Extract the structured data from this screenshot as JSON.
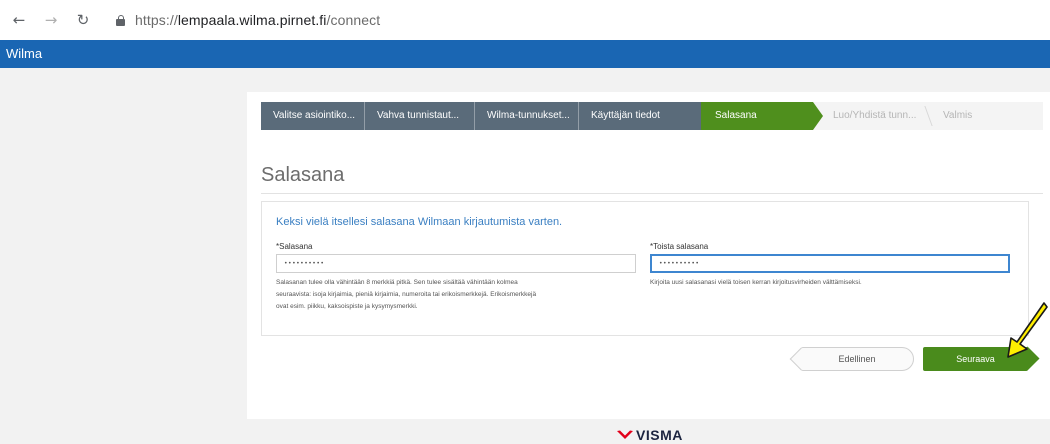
{
  "browser": {
    "url_scheme": "https://",
    "url_host": "lempaala.wilma.pirnet.fi",
    "url_path": "/connect"
  },
  "header": {
    "app_title": "Wilma"
  },
  "stepper": {
    "steps": [
      {
        "label": "Valitse asiointiko...",
        "state": "done"
      },
      {
        "label": "Vahva tunnistaut...",
        "state": "done"
      },
      {
        "label": "Wilma-tunnukset...",
        "state": "done"
      },
      {
        "label": "Käyttäjän tiedot",
        "state": "done"
      },
      {
        "label": "Salasana",
        "state": "active"
      },
      {
        "label": "Luo/Yhdistä tunn...",
        "state": "todo"
      },
      {
        "label": "Valmis",
        "state": "todo"
      }
    ]
  },
  "page": {
    "title": "Salasana"
  },
  "form": {
    "heading": "Keksi vielä itsellesi salasana Wilmaan kirjautumista varten.",
    "password": {
      "label": "*Salasana",
      "value": "••••••••••"
    },
    "password_help_1": "Salasanan tulee olla vähintään 8 merkkiä pitkä. Sen tulee sisältää vähintään kolmea",
    "password_help_2": "seuraavista: isoja kirjaimia, pieniä kirjaimia, numeroita tai erikoismerkkejä. Erikoismerkkejä",
    "password_help_3": "ovat esim. piikku, kaksoispiste ja kysymysmerkki.",
    "repeat": {
      "label": "*Toista salasana",
      "value": "••••••••••"
    },
    "repeat_help": "Kirjoita uusi salasanasi vielä toisen kerran kirjoitusvirheiden välttämiseksi."
  },
  "actions": {
    "prev_label": "Edellinen",
    "next_label": "Seuraava"
  },
  "footer": {
    "logo_text": "VISMA"
  },
  "colors": {
    "header_blue": "#1a66b3",
    "step_done": "#5a6b7a",
    "step_active": "#4f8f1d",
    "next_button": "#4a8b1c",
    "annotation_arrow": "#ffee00"
  }
}
